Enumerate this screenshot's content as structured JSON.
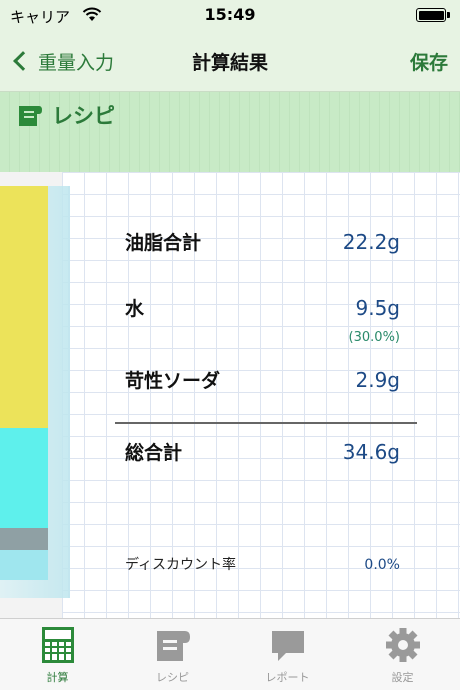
{
  "status_bar": {
    "carrier": "キャリア",
    "time": "15:49"
  },
  "nav": {
    "back_label": "重量入力",
    "title": "計算結果",
    "save_label": "保存"
  },
  "recipe": {
    "label": "レシピ"
  },
  "results": {
    "oil_label": "油脂合計",
    "oil_value": "22.2g",
    "water_label": "水",
    "water_value": "9.5g",
    "water_percent": "(30.0%)",
    "lye_label": "苛性ソーダ",
    "lye_value": "2.9g",
    "total_label": "総合計",
    "total_value": "34.6g",
    "discount_label": "ディスカウント率",
    "discount_value": "0.0%"
  },
  "tabs": [
    {
      "label": "計算",
      "icon": "calculator-icon",
      "active": true
    },
    {
      "label": "レシピ",
      "icon": "recipe-icon",
      "active": false
    },
    {
      "label": "レポート",
      "icon": "speech-bubble-icon",
      "active": false
    },
    {
      "label": "設定",
      "icon": "gear-icon",
      "active": false
    }
  ],
  "colors": {
    "accent": "#2c7a3a",
    "value": "#1d4a86",
    "oil_layer": "#ece35a",
    "water_layer": "#5ef0ec",
    "lye_layer": "#8fa0a4"
  }
}
